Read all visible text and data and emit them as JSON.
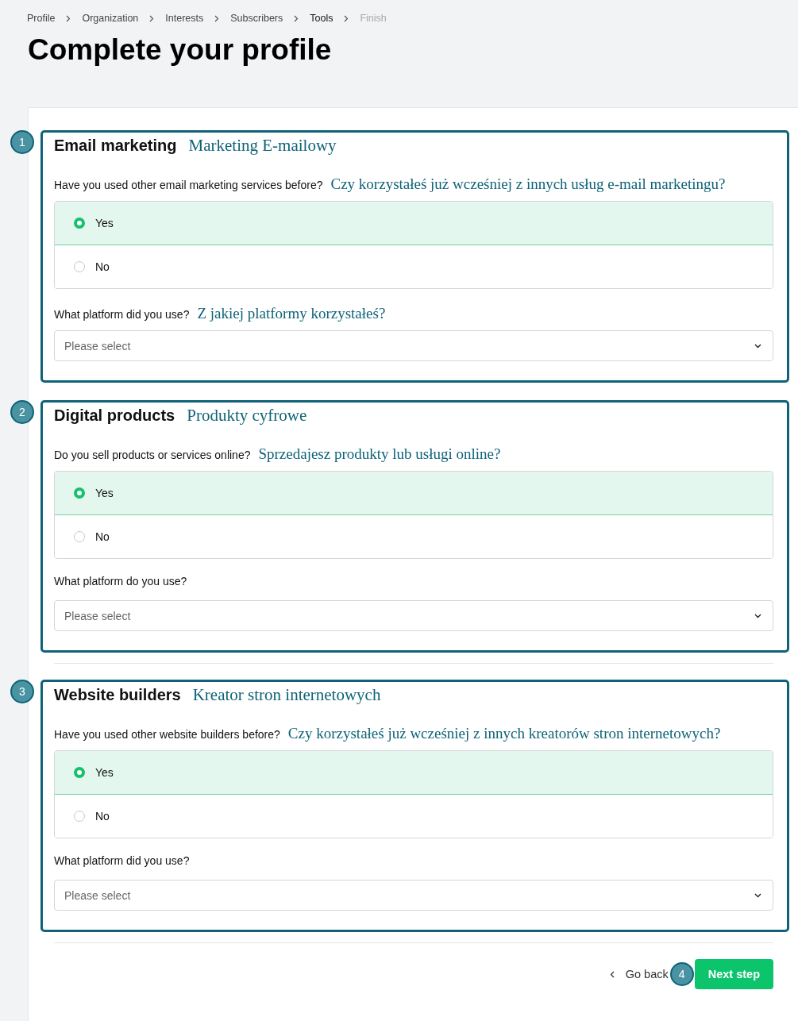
{
  "breadcrumb": [
    {
      "label": "Profile",
      "selected": false,
      "disabled": false
    },
    {
      "label": "Organization",
      "selected": false,
      "disabled": false
    },
    {
      "label": "Interests",
      "selected": false,
      "disabled": false
    },
    {
      "label": "Subscribers",
      "selected": false,
      "disabled": false
    },
    {
      "label": "Tools",
      "selected": true,
      "disabled": false
    },
    {
      "label": "Finish",
      "selected": false,
      "disabled": true
    }
  ],
  "title": "Complete your profile",
  "sections": [
    {
      "marker": "1",
      "title": "Email marketing",
      "title_translation": "Marketing E-mailowy",
      "question": "Have you used other email marketing services before?",
      "question_translation": "Czy korzystałeś już wcześniej z innych usług e-mail marketingu?",
      "options": [
        {
          "label": "Yes",
          "selected": true
        },
        {
          "label": "No",
          "selected": false
        }
      ],
      "platform_label": "What platform did you use?",
      "platform_label_translation": "Z jakiej platformy korzystałeś?",
      "select_placeholder": "Please select",
      "divider_after": false
    },
    {
      "marker": "2",
      "title": "Digital products",
      "title_translation": "Produkty cyfrowe",
      "question": "Do you sell products or services online?",
      "question_translation": "Sprzedajesz produkty lub usługi online?",
      "options": [
        {
          "label": "Yes",
          "selected": true
        },
        {
          "label": "No",
          "selected": false
        }
      ],
      "platform_label": "What platform do you use?",
      "select_placeholder": "Please select",
      "divider_after": true
    },
    {
      "marker": "3",
      "title": "Website builders",
      "title_translation": "Kreator stron internetowych",
      "question": "Have you used other website builders before?",
      "question_translation": "Czy korzystałeś już wcześniej z innych kreatorów stron internetowych?",
      "options": [
        {
          "label": "Yes",
          "selected": true
        },
        {
          "label": "No",
          "selected": false
        }
      ],
      "platform_label": "What platform did you use?",
      "select_placeholder": "Please select",
      "divider_after": true
    }
  ],
  "footer": {
    "back_label": "Go back",
    "marker": "4",
    "next_label": "Next step"
  }
}
